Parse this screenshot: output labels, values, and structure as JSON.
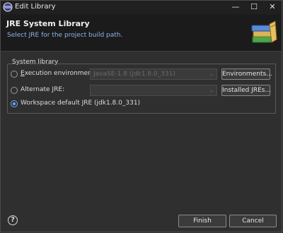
{
  "window": {
    "title": "Edit Library"
  },
  "header": {
    "title": "JRE System Library",
    "description": "Select JRE for the project build path."
  },
  "group": {
    "label": "System library",
    "options": [
      {
        "label": "Execution environment:",
        "mnemonic": "E",
        "rest": "xecution environment:",
        "selected": false,
        "combo_value": "JavaSE-1.8 (jdk1.8.0_331)",
        "button": "Environments...",
        "button_mnemonic": "m"
      },
      {
        "label": "Alternate JRE:",
        "selected": false,
        "combo_value": "",
        "button": "Installed JREs..."
      },
      {
        "label": "Workspace default JRE (jdk1.8.0_331)",
        "selected": true
      }
    ]
  },
  "footer": {
    "help_icon": "question-mark-icon",
    "finish": "Finish",
    "cancel": "Cancel"
  },
  "colors": {
    "accent": "#6aa9ff",
    "description": "#8cb4e6",
    "background": "#2f2f2f"
  }
}
